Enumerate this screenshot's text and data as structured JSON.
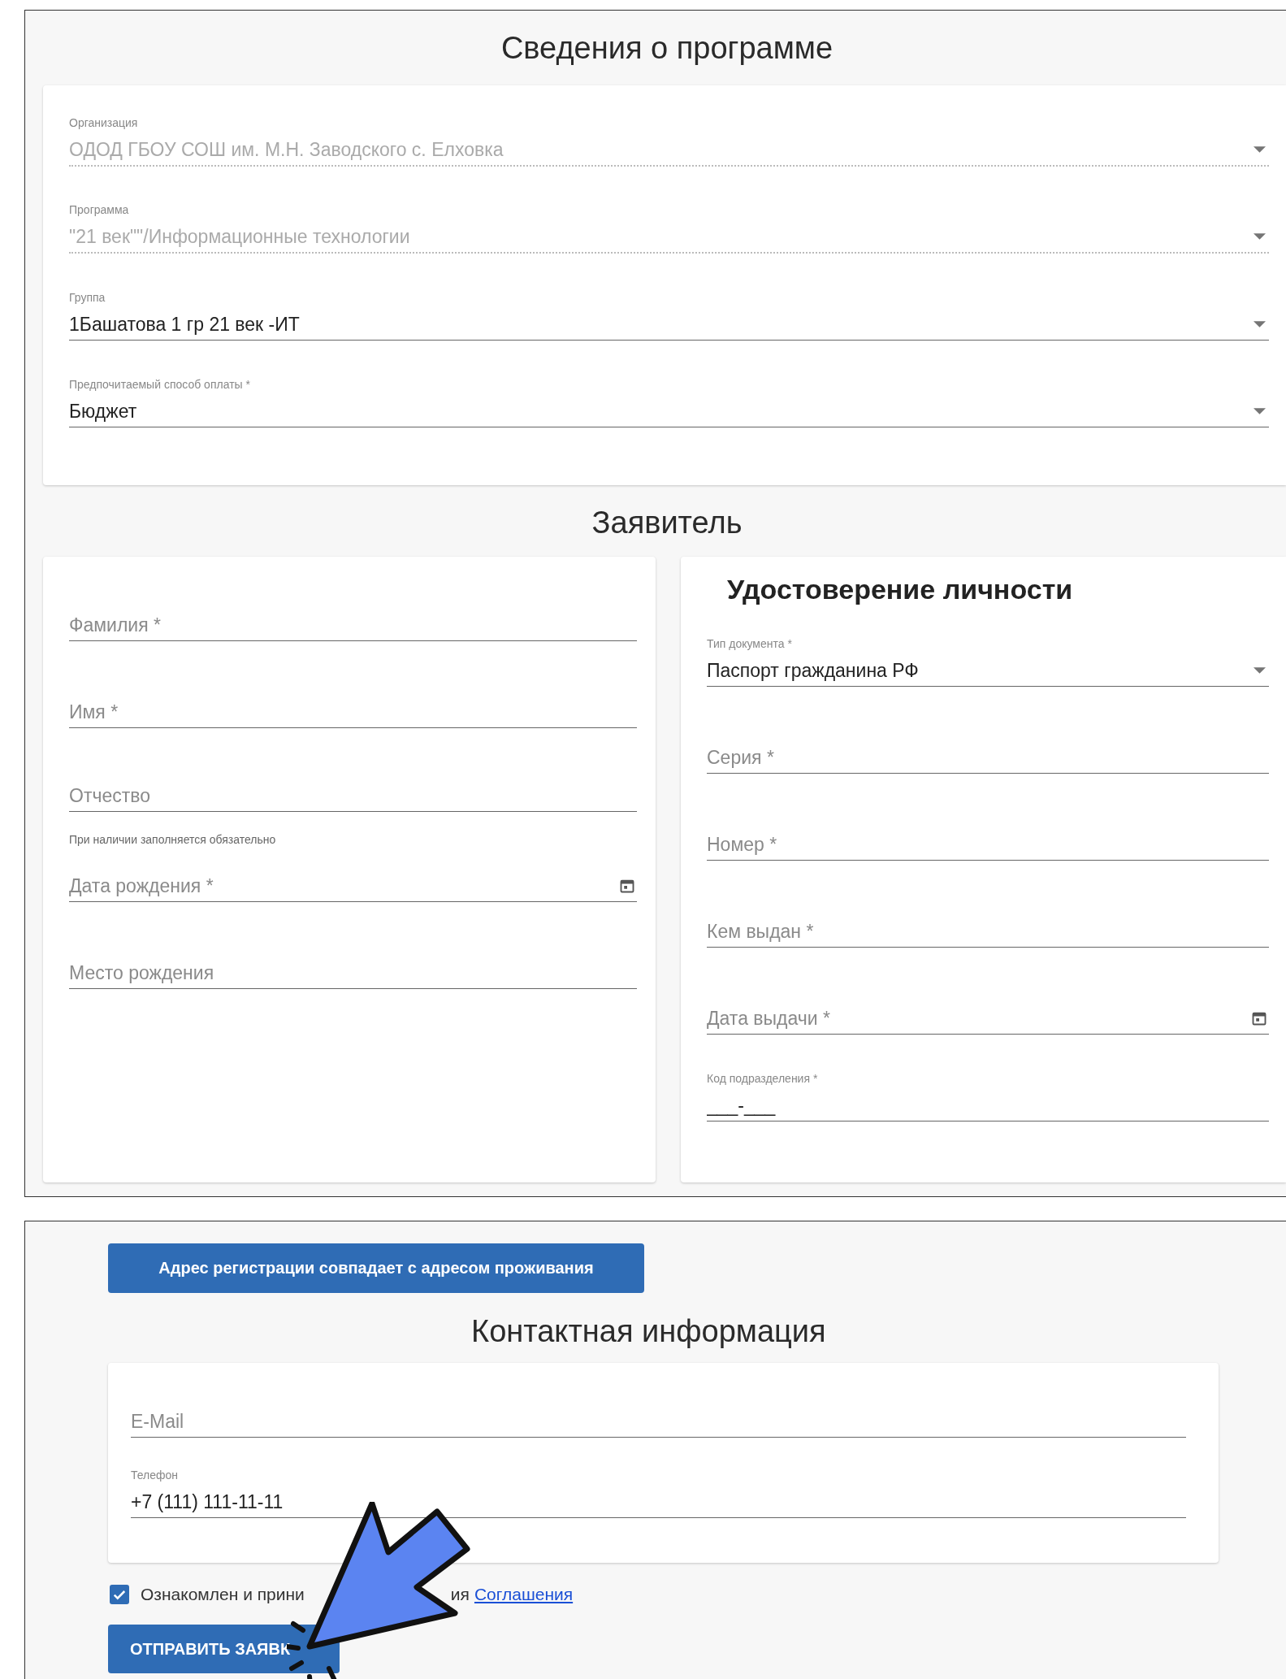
{
  "program_section": {
    "title": "Сведения о программе",
    "fields": [
      {
        "kind": "select",
        "label": "Организация",
        "value": "ОДОД ГБОУ СОШ им. М.Н. Заводского с. Елховка",
        "disabled": true
      },
      {
        "kind": "select",
        "label": "Программа",
        "value": "\"21 век\"\"/Информационные технологии",
        "disabled": true
      },
      {
        "kind": "select",
        "label": "Группа",
        "value": "1Башатова 1 гр 21 век -ИТ",
        "disabled": false
      },
      {
        "kind": "select",
        "label": "Предпочитаемый способ оплаты *",
        "value": "Бюджет",
        "disabled": false
      }
    ]
  },
  "applicant": {
    "title": "Заявитель",
    "personal_fields": [
      {
        "kind": "text",
        "placeholder": "Фамилия *"
      },
      {
        "kind": "text",
        "placeholder": "Имя *"
      },
      {
        "kind": "text",
        "placeholder": "Отчество",
        "helper": "При наличии заполняется обязательно"
      },
      {
        "kind": "date",
        "placeholder": "Дата рождения *"
      },
      {
        "kind": "text",
        "placeholder": "Место рождения"
      }
    ],
    "identity_document": {
      "title": "Удостоверение личности",
      "fields": [
        {
          "kind": "select",
          "label": "Тип документа *",
          "value": "Паспорт гражданина РФ"
        },
        {
          "kind": "text",
          "placeholder": "Серия *"
        },
        {
          "kind": "text",
          "placeholder": "Номер *"
        },
        {
          "kind": "text",
          "placeholder": "Кем выдан *"
        },
        {
          "kind": "date",
          "placeholder": "Дата выдачи *"
        },
        {
          "kind": "text",
          "label": "Код подразделения *",
          "value": "___-___"
        }
      ]
    }
  },
  "address_button": "Адрес регистрации совпадает с адресом проживания",
  "contacts": {
    "title": "Контактная информация",
    "fields": [
      {
        "kind": "text",
        "placeholder": "E-Mail"
      },
      {
        "kind": "text",
        "label": "Телефон",
        "value": "+7 (111) 111-11-11"
      }
    ]
  },
  "agreement": {
    "checked": true,
    "text_parts": [
      "Ознакомлен и прини",
      "ия"
    ],
    "link": "Соглашения"
  },
  "submit_button": "ОТПРАВИТЬ ЗАЯВК"
}
